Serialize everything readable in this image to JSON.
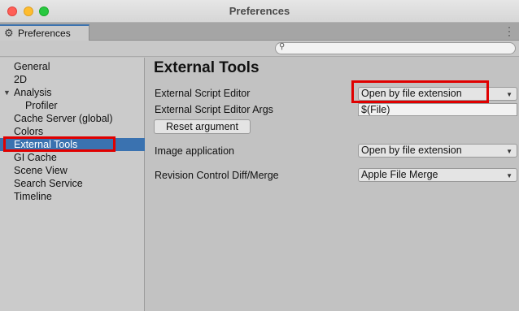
{
  "window": {
    "title": "Preferences"
  },
  "tab": {
    "label": "Preferences",
    "icon": "gear-icon"
  },
  "search": {
    "placeholder": "",
    "value": ""
  },
  "sidebar": {
    "items": [
      {
        "label": "General"
      },
      {
        "label": "2D"
      },
      {
        "label": "Analysis"
      },
      {
        "label": "Profiler"
      },
      {
        "label": "Cache Server (global)"
      },
      {
        "label": "Colors"
      },
      {
        "label": "External Tools"
      },
      {
        "label": "GI Cache"
      },
      {
        "label": "Scene View"
      },
      {
        "label": "Search Service"
      },
      {
        "label": "Timeline"
      }
    ],
    "selected": "External Tools"
  },
  "content": {
    "heading": "External Tools",
    "script_editor_label": "External Script Editor",
    "script_editor_value": "Open by file extension",
    "script_editor_args_label": "External Script Editor Args",
    "script_editor_args_value": "$(File)",
    "reset_argument_label": "Reset argument",
    "image_app_label": "Image application",
    "image_app_value": "Open by file extension",
    "revision_label": "Revision Control Diff/Merge",
    "revision_value": "Apple File Merge"
  },
  "colors": {
    "selection": "#3a72b0",
    "highlight": "#e00000",
    "traffic_close": "#ff5f57",
    "traffic_min": "#febc2e",
    "traffic_max": "#28c840"
  }
}
